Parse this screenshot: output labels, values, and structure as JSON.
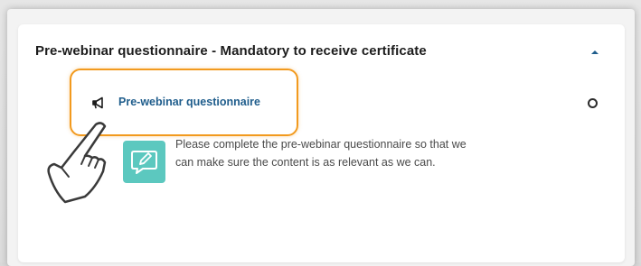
{
  "section": {
    "title": "Pre-webinar questionnaire - Mandatory to receive certificate",
    "toggle_icon": "caret-up-icon"
  },
  "item": {
    "icon": "megaphone-icon",
    "link_label": "Pre-webinar questionnaire",
    "status_icon": "circle-outline-icon",
    "description": "Please complete the pre-webinar questionnaire so that we can make sure the content is as relevant as we can.",
    "description_icon": "chat-edit-icon"
  },
  "overlay": {
    "pointer_icon": "hand-pointer-icon",
    "highlight_color": "#f29a1e"
  },
  "colors": {
    "link": "#1f5d8c",
    "icon_tile": "#5cc8bf",
    "toggle": "#1f5d8c"
  }
}
